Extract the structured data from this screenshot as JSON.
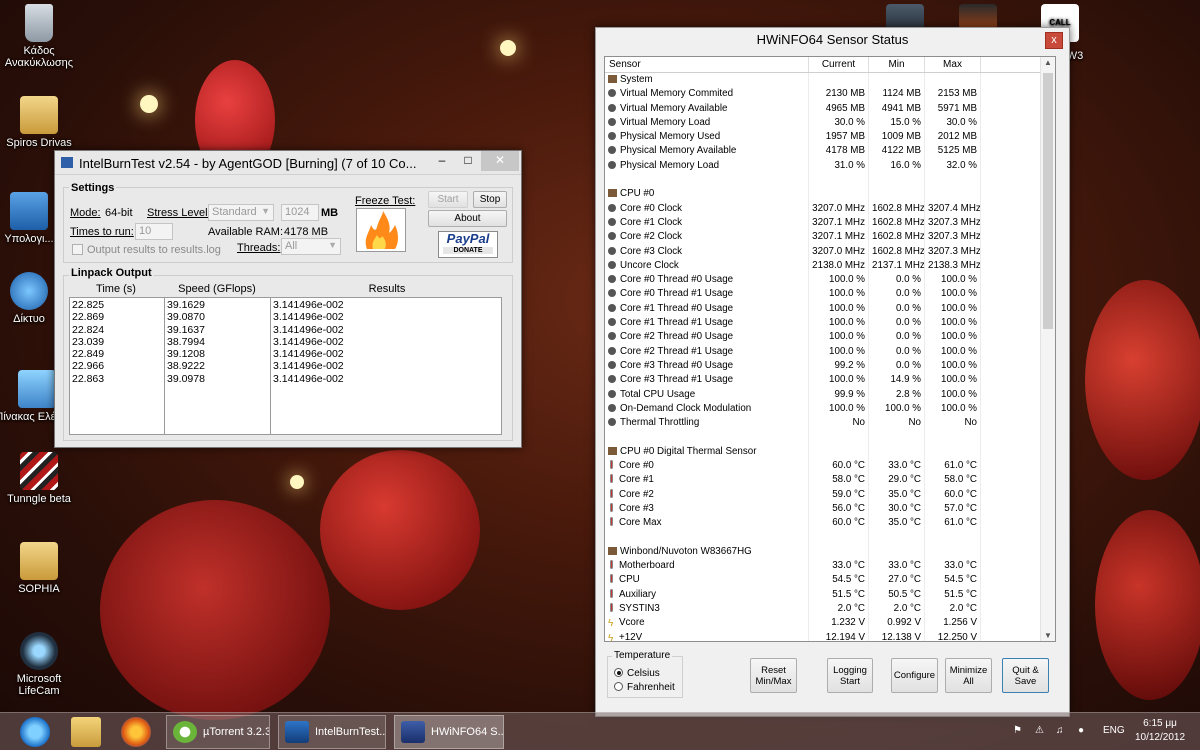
{
  "desktop": {
    "icons": [
      {
        "label": "Κάδος Ανακύκλωσης"
      },
      {
        "label": "Spiros Drivas"
      },
      {
        "label": "Υπολογι..."
      },
      {
        "label": "Δίκτυο"
      },
      {
        "label": "Πίνακας Ελέγχου"
      },
      {
        "label": "Tunngle beta"
      },
      {
        "label": "SOPHIA"
      },
      {
        "label": "Microsoft LifeCam"
      },
      {
        "label": "W3"
      }
    ],
    "cod_label": "CALL DUTY"
  },
  "ibt": {
    "title": "IntelBurnTest v2.54 - by AgentGOD [Burning] (7 of 10 Co...",
    "settings_title": "Settings",
    "mode_label": "Mode:",
    "mode_value": "64-bit",
    "stress_label": "Stress Level:",
    "stress_value": "Standard",
    "mem_value": "1024",
    "mem_unit": "MB",
    "times_label": "Times to run:",
    "times_value": "10",
    "ram_label": "Available RAM:",
    "ram_value": "4178 MB",
    "output_label": "Output results to results.log",
    "threads_label": "Threads:",
    "threads_value": "All",
    "freeze_label": "Freeze Test:",
    "start_label": "Start",
    "stop_label": "Stop",
    "about_label": "About",
    "paypal_label": "PayPal",
    "donate_label": "DONATE",
    "linpack_title": "Linpack Output",
    "col_time": "Time (s)",
    "col_speed": "Speed (GFlops)",
    "col_results": "Results",
    "times": [
      "22.825",
      "22.869",
      "22.824",
      "23.039",
      "22.849",
      "22.966",
      "22.863"
    ],
    "speeds": [
      "39.1629",
      "39.0870",
      "39.1637",
      "38.7994",
      "39.1208",
      "38.9222",
      "39.0978"
    ],
    "results": [
      "3.141496e-002",
      "3.141496e-002",
      "3.141496e-002",
      "3.141496e-002",
      "3.141496e-002",
      "3.141496e-002",
      "3.141496e-002"
    ]
  },
  "hw": {
    "title": "HWiNFO64 Sensor Status",
    "close": "x",
    "headers": {
      "sensor": "Sensor",
      "current": "Current",
      "min": "Min",
      "max": "Max"
    },
    "rows": [
      {
        "type": "group",
        "name": "System"
      },
      {
        "type": "item",
        "icon": "dot",
        "name": "Virtual Memory Commited",
        "cur": "2130 MB",
        "min": "1124 MB",
        "max": "2153 MB"
      },
      {
        "type": "item",
        "icon": "dot",
        "name": "Virtual Memory Available",
        "cur": "4965 MB",
        "min": "4941 MB",
        "max": "5971 MB"
      },
      {
        "type": "item",
        "icon": "dot",
        "name": "Virtual Memory Load",
        "cur": "30.0 %",
        "min": "15.0 %",
        "max": "30.0 %"
      },
      {
        "type": "item",
        "icon": "dot",
        "name": "Physical Memory Used",
        "cur": "1957 MB",
        "min": "1009 MB",
        "max": "2012 MB"
      },
      {
        "type": "item",
        "icon": "dot",
        "name": "Physical Memory Available",
        "cur": "4178 MB",
        "min": "4122 MB",
        "max": "5125 MB"
      },
      {
        "type": "item",
        "icon": "dot",
        "name": "Physical Memory Load",
        "cur": "31.0 %",
        "min": "16.0 %",
        "max": "32.0 %"
      },
      {
        "type": "blank"
      },
      {
        "type": "group",
        "name": "CPU #0"
      },
      {
        "type": "item",
        "icon": "dot",
        "name": "Core #0 Clock",
        "cur": "3207.0 MHz",
        "min": "1602.8 MHz",
        "max": "3207.4 MHz"
      },
      {
        "type": "item",
        "icon": "dot",
        "name": "Core #1 Clock",
        "cur": "3207.1 MHz",
        "min": "1602.8 MHz",
        "max": "3207.3 MHz"
      },
      {
        "type": "item",
        "icon": "dot",
        "name": "Core #2 Clock",
        "cur": "3207.1 MHz",
        "min": "1602.8 MHz",
        "max": "3207.3 MHz"
      },
      {
        "type": "item",
        "icon": "dot",
        "name": "Core #3 Clock",
        "cur": "3207.0 MHz",
        "min": "1602.8 MHz",
        "max": "3207.3 MHz"
      },
      {
        "type": "item",
        "icon": "dot",
        "name": "Uncore Clock",
        "cur": "2138.0 MHz",
        "min": "2137.1 MHz",
        "max": "2138.3 MHz"
      },
      {
        "type": "item",
        "icon": "dot",
        "name": "Core #0 Thread #0 Usage",
        "cur": "100.0 %",
        "min": "0.0 %",
        "max": "100.0 %"
      },
      {
        "type": "item",
        "icon": "dot",
        "name": "Core #0 Thread #1 Usage",
        "cur": "100.0 %",
        "min": "0.0 %",
        "max": "100.0 %"
      },
      {
        "type": "item",
        "icon": "dot",
        "name": "Core #1 Thread #0 Usage",
        "cur": "100.0 %",
        "min": "0.0 %",
        "max": "100.0 %"
      },
      {
        "type": "item",
        "icon": "dot",
        "name": "Core #1 Thread #1 Usage",
        "cur": "100.0 %",
        "min": "0.0 %",
        "max": "100.0 %"
      },
      {
        "type": "item",
        "icon": "dot",
        "name": "Core #2 Thread #0 Usage",
        "cur": "100.0 %",
        "min": "0.0 %",
        "max": "100.0 %"
      },
      {
        "type": "item",
        "icon": "dot",
        "name": "Core #2 Thread #1 Usage",
        "cur": "100.0 %",
        "min": "0.0 %",
        "max": "100.0 %"
      },
      {
        "type": "item",
        "icon": "dot",
        "name": "Core #3 Thread #0 Usage",
        "cur": "99.2 %",
        "min": "0.0 %",
        "max": "100.0 %"
      },
      {
        "type": "item",
        "icon": "dot",
        "name": "Core #3 Thread #1 Usage",
        "cur": "100.0 %",
        "min": "14.9 %",
        "max": "100.0 %"
      },
      {
        "type": "item",
        "icon": "dot",
        "name": "Total CPU Usage",
        "cur": "99.9 %",
        "min": "2.8 %",
        "max": "100.0 %"
      },
      {
        "type": "item",
        "icon": "dot",
        "name": "On-Demand Clock Modulation",
        "cur": "100.0 %",
        "min": "100.0 %",
        "max": "100.0 %"
      },
      {
        "type": "item",
        "icon": "dot",
        "name": "Thermal Throttling",
        "cur": "No",
        "min": "No",
        "max": "No"
      },
      {
        "type": "blank"
      },
      {
        "type": "group",
        "name": "CPU #0 Digital Thermal Sensor"
      },
      {
        "type": "item",
        "icon": "therm",
        "name": "Core #0",
        "cur": "60.0 °C",
        "min": "33.0 °C",
        "max": "61.0 °C"
      },
      {
        "type": "item",
        "icon": "therm",
        "name": "Core #1",
        "cur": "58.0 °C",
        "min": "29.0 °C",
        "max": "58.0 °C"
      },
      {
        "type": "item",
        "icon": "therm",
        "name": "Core #2",
        "cur": "59.0 °C",
        "min": "35.0 °C",
        "max": "60.0 °C"
      },
      {
        "type": "item",
        "icon": "therm",
        "name": "Core #3",
        "cur": "56.0 °C",
        "min": "30.0 °C",
        "max": "57.0 °C"
      },
      {
        "type": "item",
        "icon": "therm",
        "name": "Core Max",
        "cur": "60.0 °C",
        "min": "35.0 °C",
        "max": "61.0 °C"
      },
      {
        "type": "blank"
      },
      {
        "type": "group",
        "name": "Winbond/Nuvoton W83667HG"
      },
      {
        "type": "item",
        "icon": "therm",
        "name": "Motherboard",
        "cur": "33.0 °C",
        "min": "33.0 °C",
        "max": "33.0 °C"
      },
      {
        "type": "item",
        "icon": "therm",
        "name": "CPU",
        "cur": "54.5 °C",
        "min": "27.0 °C",
        "max": "54.5 °C"
      },
      {
        "type": "item",
        "icon": "therm",
        "name": "Auxiliary",
        "cur": "51.5 °C",
        "min": "50.5 °C",
        "max": "51.5 °C"
      },
      {
        "type": "item",
        "icon": "therm",
        "name": "SYSTIN3",
        "cur": "2.0 °C",
        "min": "2.0 °C",
        "max": "2.0 °C"
      },
      {
        "type": "item",
        "icon": "volt",
        "name": "Vcore",
        "cur": "1.232 V",
        "min": "0.992 V",
        "max": "1.256 V"
      },
      {
        "type": "item",
        "icon": "volt",
        "name": "+12V",
        "cur": "12.194 V",
        "min": "12.138 V",
        "max": "12.250 V"
      }
    ],
    "temp_title": "Temperature",
    "celsius": "Celsius",
    "fahrenheit": "Fahrenheit",
    "btn_reset": "Reset Min/Max",
    "btn_logging": "Logging Start",
    "btn_configure": "Configure",
    "btn_minimize": "Minimize All",
    "btn_quit": "Quit & Save"
  },
  "taskbar": {
    "utorrent": "µTorrent 3.2.3",
    "ibt": "IntelBurnTest...",
    "hwinfo": "HWiNFO64 S...",
    "lang": "ENG",
    "time": "6:15 μμ",
    "date": "10/12/2012"
  },
  "colors": {
    "close_red": "#c74a3a",
    "taskbar": "#786464",
    "link_blue": "#1a5fb4"
  }
}
